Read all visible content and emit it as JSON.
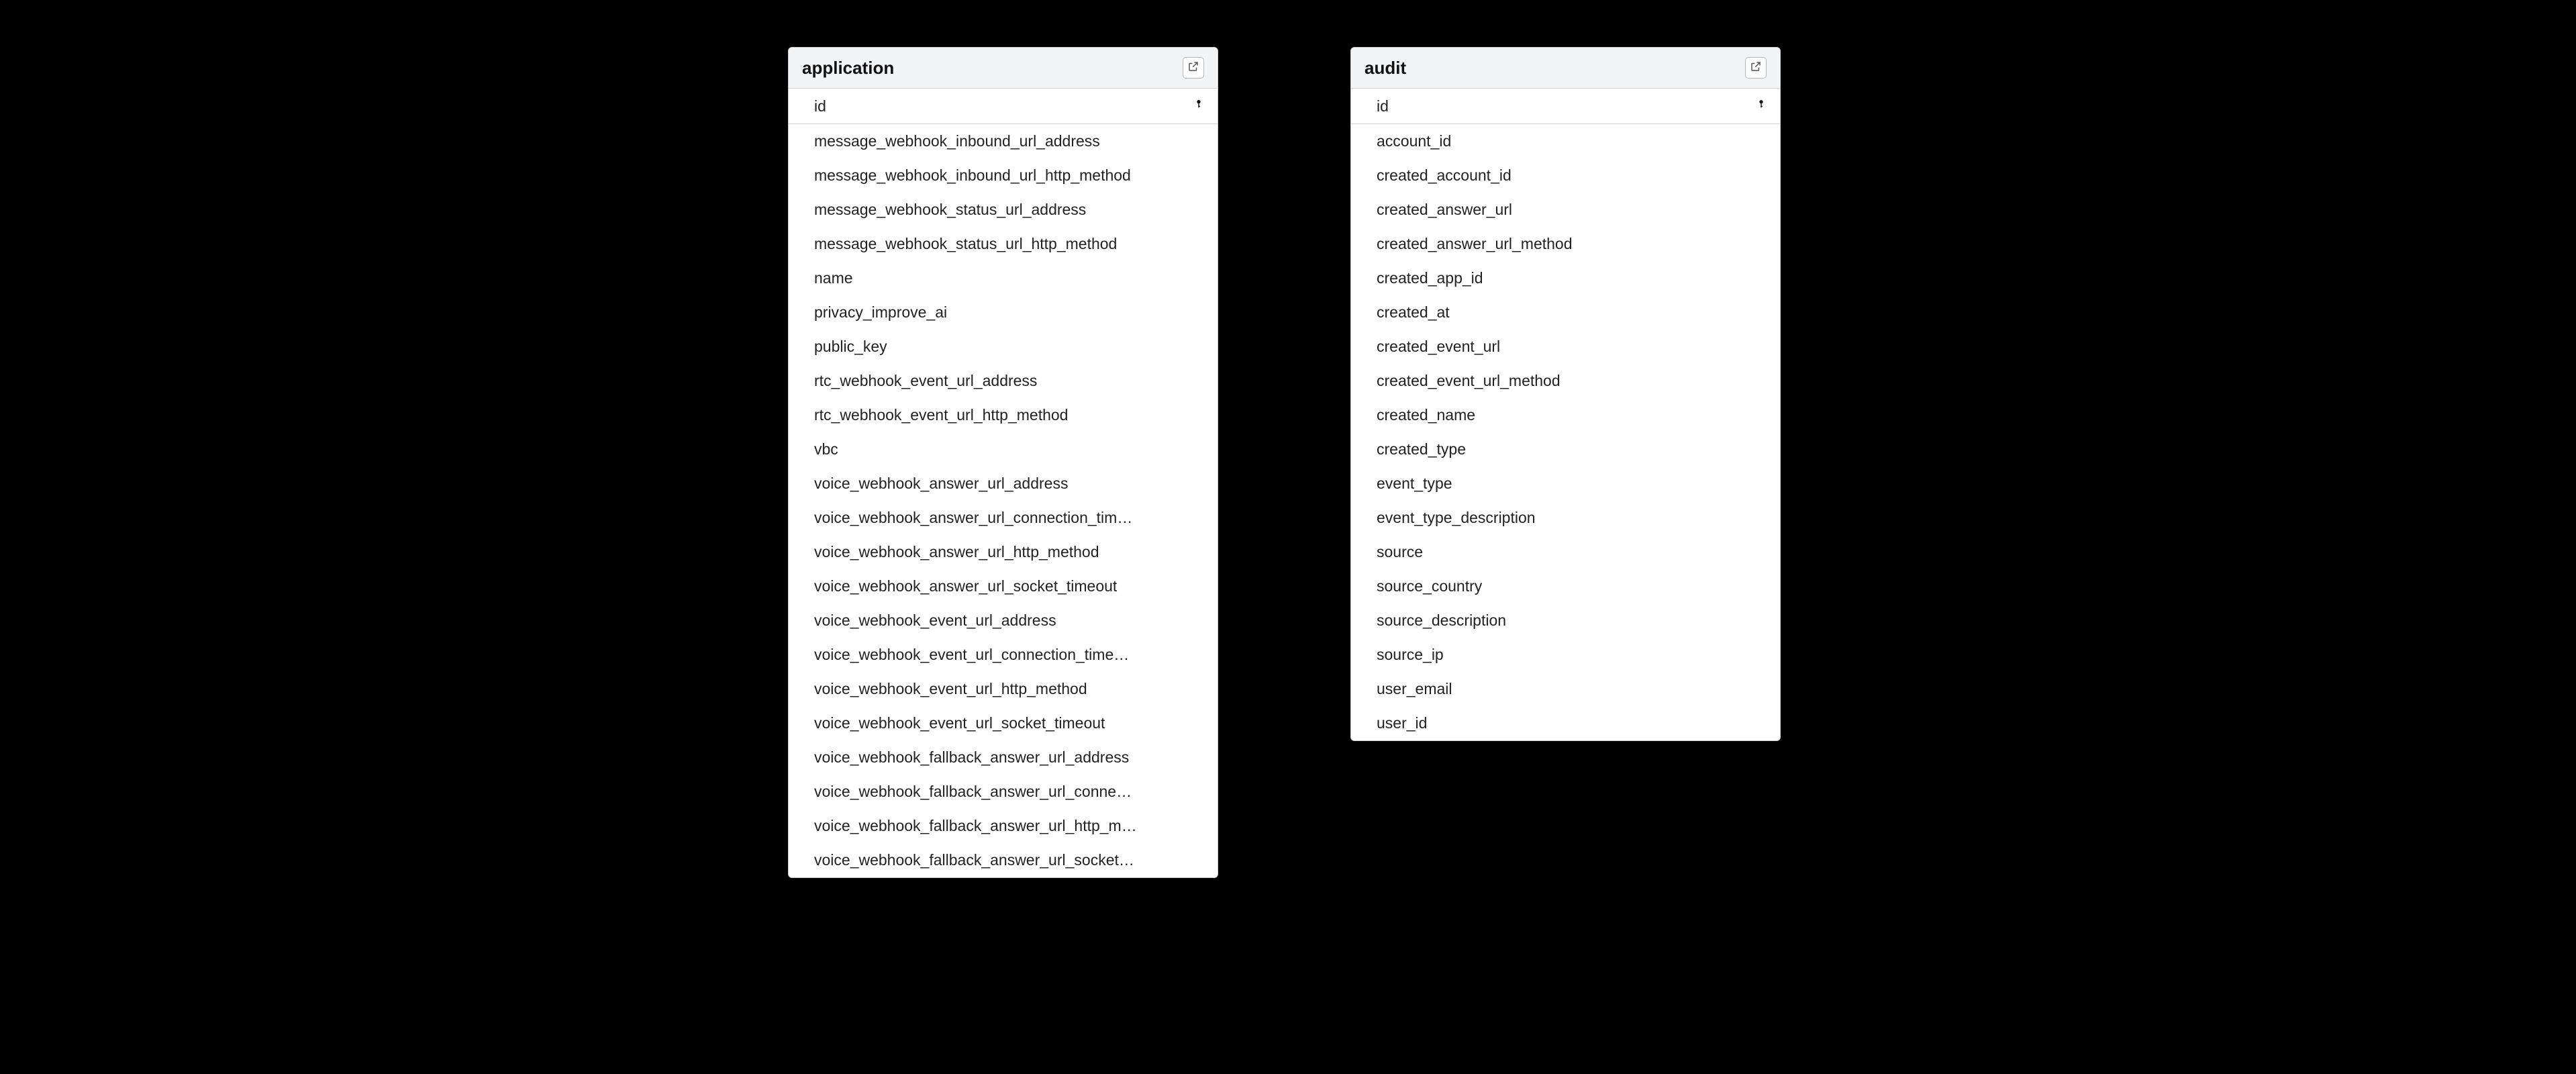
{
  "tables": {
    "application": {
      "title": "application",
      "pk": "id",
      "fields": [
        "message_webhook_inbound_url_address",
        "message_webhook_inbound_url_http_method",
        "message_webhook_status_url_address",
        "message_webhook_status_url_http_method",
        "name",
        "privacy_improve_ai",
        "public_key",
        "rtc_webhook_event_url_address",
        "rtc_webhook_event_url_http_method",
        "vbc",
        "voice_webhook_answer_url_address",
        "voice_webhook_answer_url_connection_tim…",
        "voice_webhook_answer_url_http_method",
        "voice_webhook_answer_url_socket_timeout",
        "voice_webhook_event_url_address",
        "voice_webhook_event_url_connection_time…",
        "voice_webhook_event_url_http_method",
        "voice_webhook_event_url_socket_timeout",
        "voice_webhook_fallback_answer_url_address",
        "voice_webhook_fallback_answer_url_conne…",
        "voice_webhook_fallback_answer_url_http_m…",
        "voice_webhook_fallback_answer_url_socket…"
      ]
    },
    "audit": {
      "title": "audit",
      "pk": "id",
      "fields": [
        "account_id",
        "created_account_id",
        "created_answer_url",
        "created_answer_url_method",
        "created_app_id",
        "created_at",
        "created_event_url",
        "created_event_url_method",
        "created_name",
        "created_type",
        "event_type",
        "event_type_description",
        "source",
        "source_country",
        "source_description",
        "source_ip",
        "user_email",
        "user_id"
      ]
    }
  }
}
